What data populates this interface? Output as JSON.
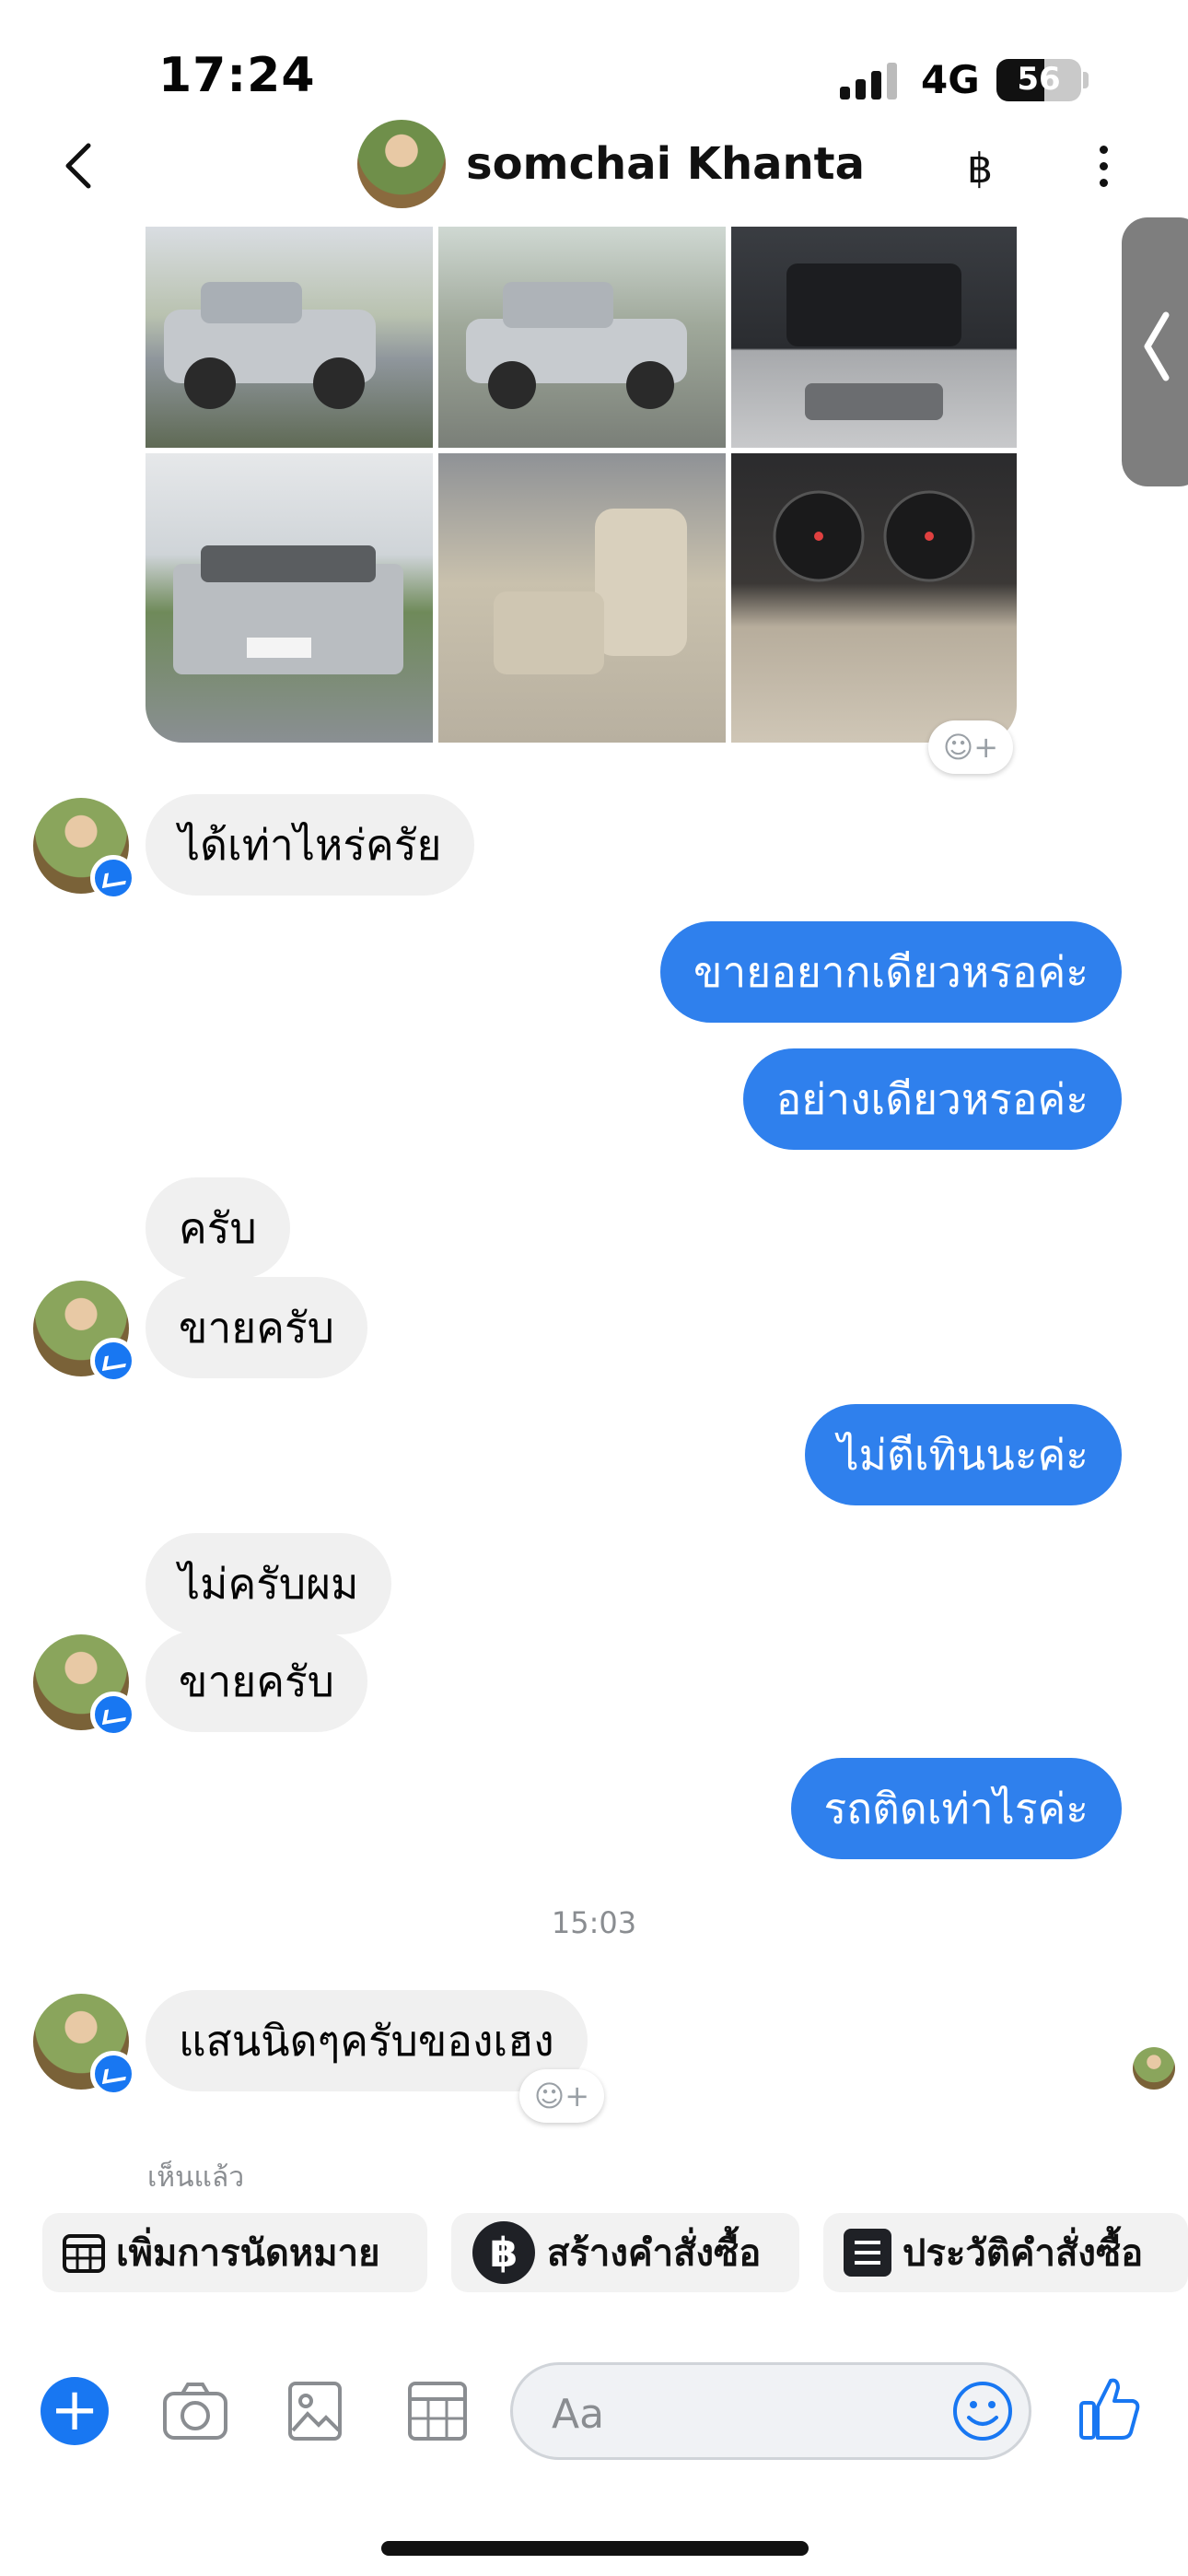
{
  "status_bar": {
    "time": "17:24",
    "network": "4G",
    "battery": "56",
    "battery_level_percent": 56
  },
  "header": {
    "contact_name": "somchai Khanta"
  },
  "messages": [
    {
      "side": "in",
      "text": "ได้เท่าไหร่ครัย"
    },
    {
      "side": "out",
      "text": "ขายอยากเดียวหรอค่ะ"
    },
    {
      "side": "out",
      "text": "อย่างเดียวหรอค่ะ"
    },
    {
      "side": "in",
      "text": "ครับ"
    },
    {
      "side": "in",
      "text": "ขายครับ"
    },
    {
      "side": "out",
      "text": "ไม่ตีเทินนะค่ะ"
    },
    {
      "side": "in",
      "text": "ไม่ครับผม"
    },
    {
      "side": "in",
      "text": "ขายครับ"
    },
    {
      "side": "out",
      "text": "รถติดเท่าไรค่ะ"
    },
    {
      "side": "in",
      "text": "แสนนิดๆครับของเฮง"
    }
  ],
  "timestamp": "15:03",
  "seen_label": "เห็นแล้ว",
  "quick_actions": [
    {
      "label": "เพิ่มการนัดหมาย",
      "icon": "calendar-icon"
    },
    {
      "label": "สร้างคำสั่งซื้อ",
      "icon": "baht-icon"
    },
    {
      "label": "ประวัติคำสั่งซื้อ",
      "icon": "order-list-icon"
    }
  ],
  "composer": {
    "placeholder": "Aa"
  },
  "colors": {
    "accent": "#1877f2",
    "outgoing_bubble": "#2f80ed",
    "incoming_bubble": "#f0f0f0"
  }
}
